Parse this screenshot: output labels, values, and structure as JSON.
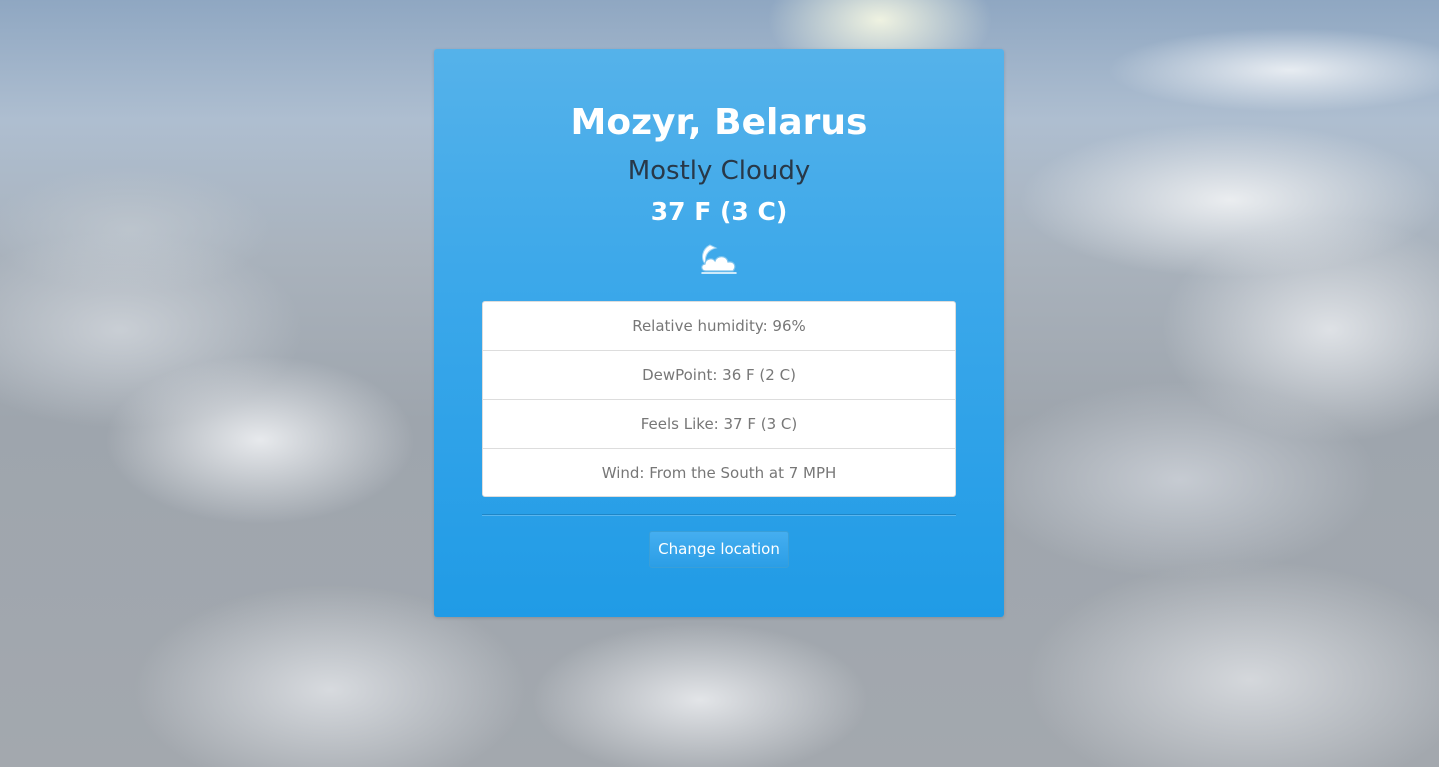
{
  "location": {
    "city": "Mozyr, Belarus"
  },
  "current": {
    "condition": "Mostly Cloudy",
    "temperature": "37 F (3 C)",
    "icon": "mostly-cloudy-night-icon"
  },
  "details": [
    {
      "label": "Relative humidity: 96%"
    },
    {
      "label": "DewPoint: 36 F (2 C)"
    },
    {
      "label": "Feels Like: 37 F (3 C)"
    },
    {
      "label": "Wind: From the South at 7 MPH"
    }
  ],
  "actions": {
    "change_location_label": "Change location"
  },
  "colors": {
    "card_top": "#55b2ea",
    "card_bottom": "#209be6",
    "condition_text": "#283848",
    "detail_text": "#777777"
  }
}
